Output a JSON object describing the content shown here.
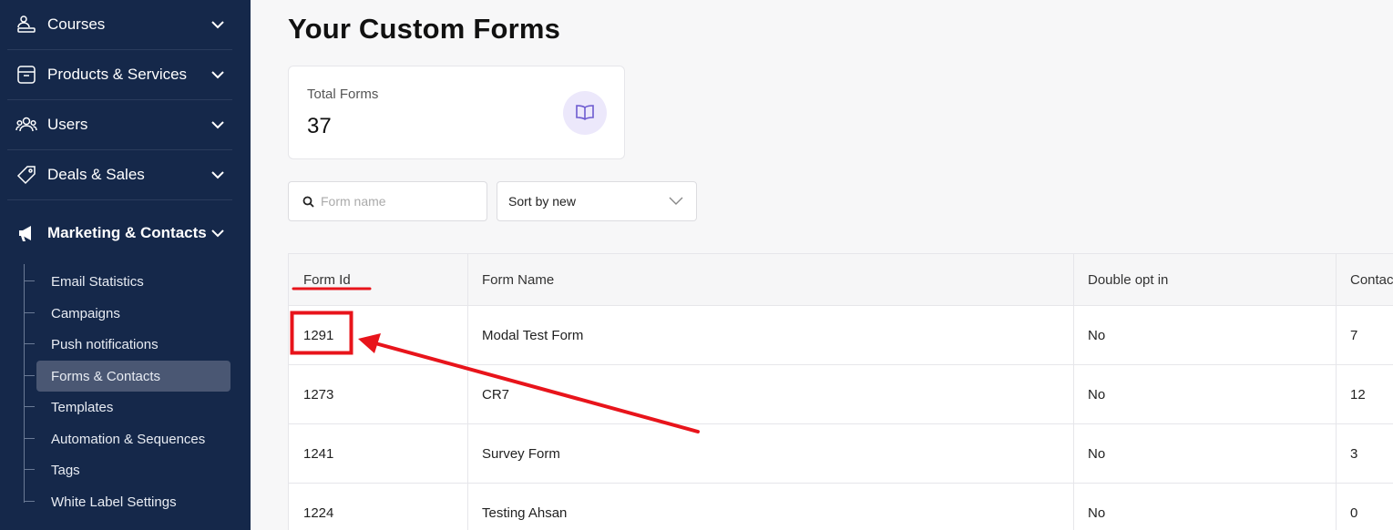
{
  "sidebar": {
    "items": [
      {
        "label": "Courses",
        "icon": "courses-icon"
      },
      {
        "label": "Products & Services",
        "icon": "box-icon"
      },
      {
        "label": "Users",
        "icon": "users-icon"
      },
      {
        "label": "Deals & Sales",
        "icon": "tag-icon"
      },
      {
        "label": "Marketing & Contacts",
        "icon": "megaphone-icon"
      }
    ],
    "subitems": [
      {
        "label": "Email Statistics"
      },
      {
        "label": "Campaigns"
      },
      {
        "label": "Push notifications"
      },
      {
        "label": "Forms & Contacts",
        "active": true
      },
      {
        "label": "Templates"
      },
      {
        "label": "Automation & Sequences"
      },
      {
        "label": "Tags"
      },
      {
        "label": "White Label Settings"
      }
    ]
  },
  "main": {
    "title": "Your Custom Forms",
    "stat": {
      "label": "Total Forms",
      "value": "37",
      "icon": "book-icon"
    },
    "search": {
      "placeholder": "Form name"
    },
    "sort": {
      "selected": "Sort by new"
    },
    "table": {
      "columns": [
        "Form Id",
        "Form Name",
        "Double opt in",
        "Contac"
      ],
      "rows": [
        {
          "id": "1291",
          "name": "Modal Test Form",
          "double_opt_in": "No",
          "contacts": "7"
        },
        {
          "id": "1273",
          "name": "CR7",
          "double_opt_in": "No",
          "contacts": "12"
        },
        {
          "id": "1241",
          "name": "Survey Form",
          "double_opt_in": "No",
          "contacts": "3"
        },
        {
          "id": "1224",
          "name": "Testing Ahsan",
          "double_opt_in": "No",
          "contacts": "0"
        }
      ]
    }
  },
  "colors": {
    "sidebar_bg": "#15284a",
    "sidebar_active": "#4a5773",
    "annotation_red": "#e8141b",
    "stat_icon_bg": "#ece8fb",
    "stat_icon_fg": "#6d5bd0"
  }
}
